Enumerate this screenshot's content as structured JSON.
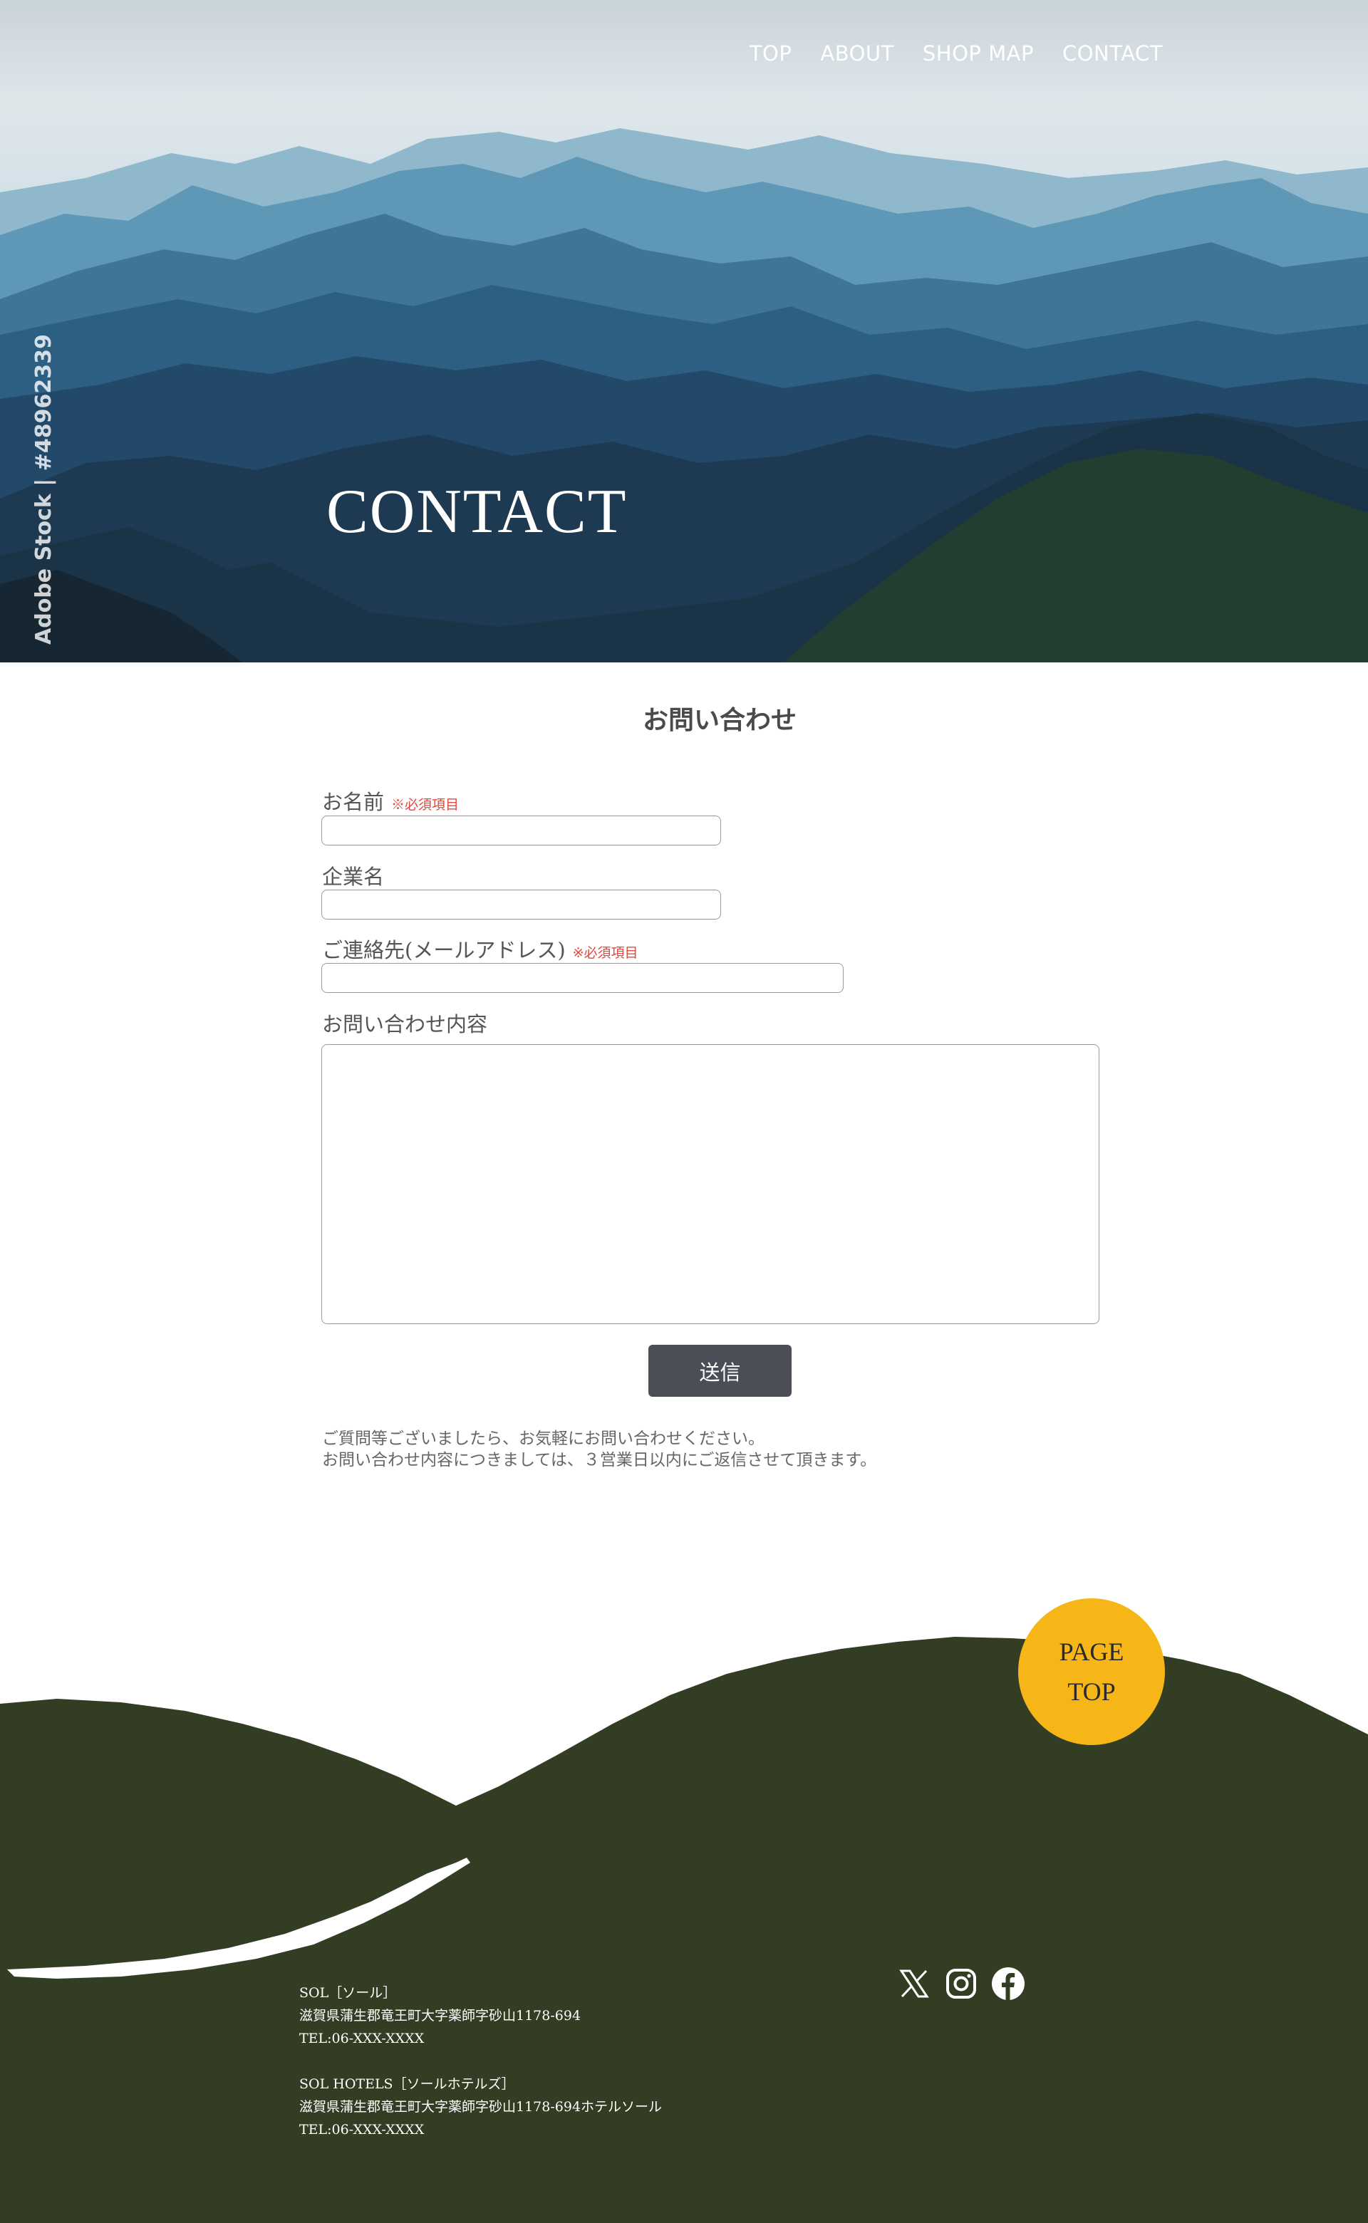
{
  "nav": {
    "items": [
      {
        "label": "TOP"
      },
      {
        "label": "ABOUT"
      },
      {
        "label": "SHOP MAP"
      },
      {
        "label": "CONTACT"
      }
    ]
  },
  "hero": {
    "title": "CONTACT",
    "stock_credit": "Adobe Stock | #48962339"
  },
  "form": {
    "heading": "お問い合わせ",
    "name_label": "お名前",
    "required_mark": "※必須項目",
    "company_label": "企業名",
    "email_label": "ご連絡先(メールアドレス)",
    "message_label": "お問い合わせ内容",
    "submit_label": "送信",
    "note_line1": "ご質問等ございましたら、お気軽にお問い合わせください。",
    "note_line2": "お問い合わせ内容につきましては、３営業日以内にご返信させて頂きます。"
  },
  "page_top": {
    "line1": "PAGE",
    "line2": "TOP"
  },
  "footer": {
    "sol": {
      "name": "SOL［ソール］",
      "address": "滋賀県蒲生郡竜王町大字薬師字砂山1178-694",
      "tel": "TEL:06-XXX-XXXX"
    },
    "hotels": {
      "name": "SOL HOTELS［ソールホテルズ］",
      "address": "滋賀県蒲生郡竜王町大字薬師字砂山1178-694ホテルソール",
      "tel": "TEL:06-XXX-XXXX"
    },
    "social": [
      "x-icon",
      "instagram-icon",
      "facebook-icon"
    ]
  },
  "colors": {
    "footer_green": "#333d24",
    "page_top_yellow": "#f6b617",
    "submit_bg": "#4b4d57",
    "required_red": "#e0483e"
  }
}
